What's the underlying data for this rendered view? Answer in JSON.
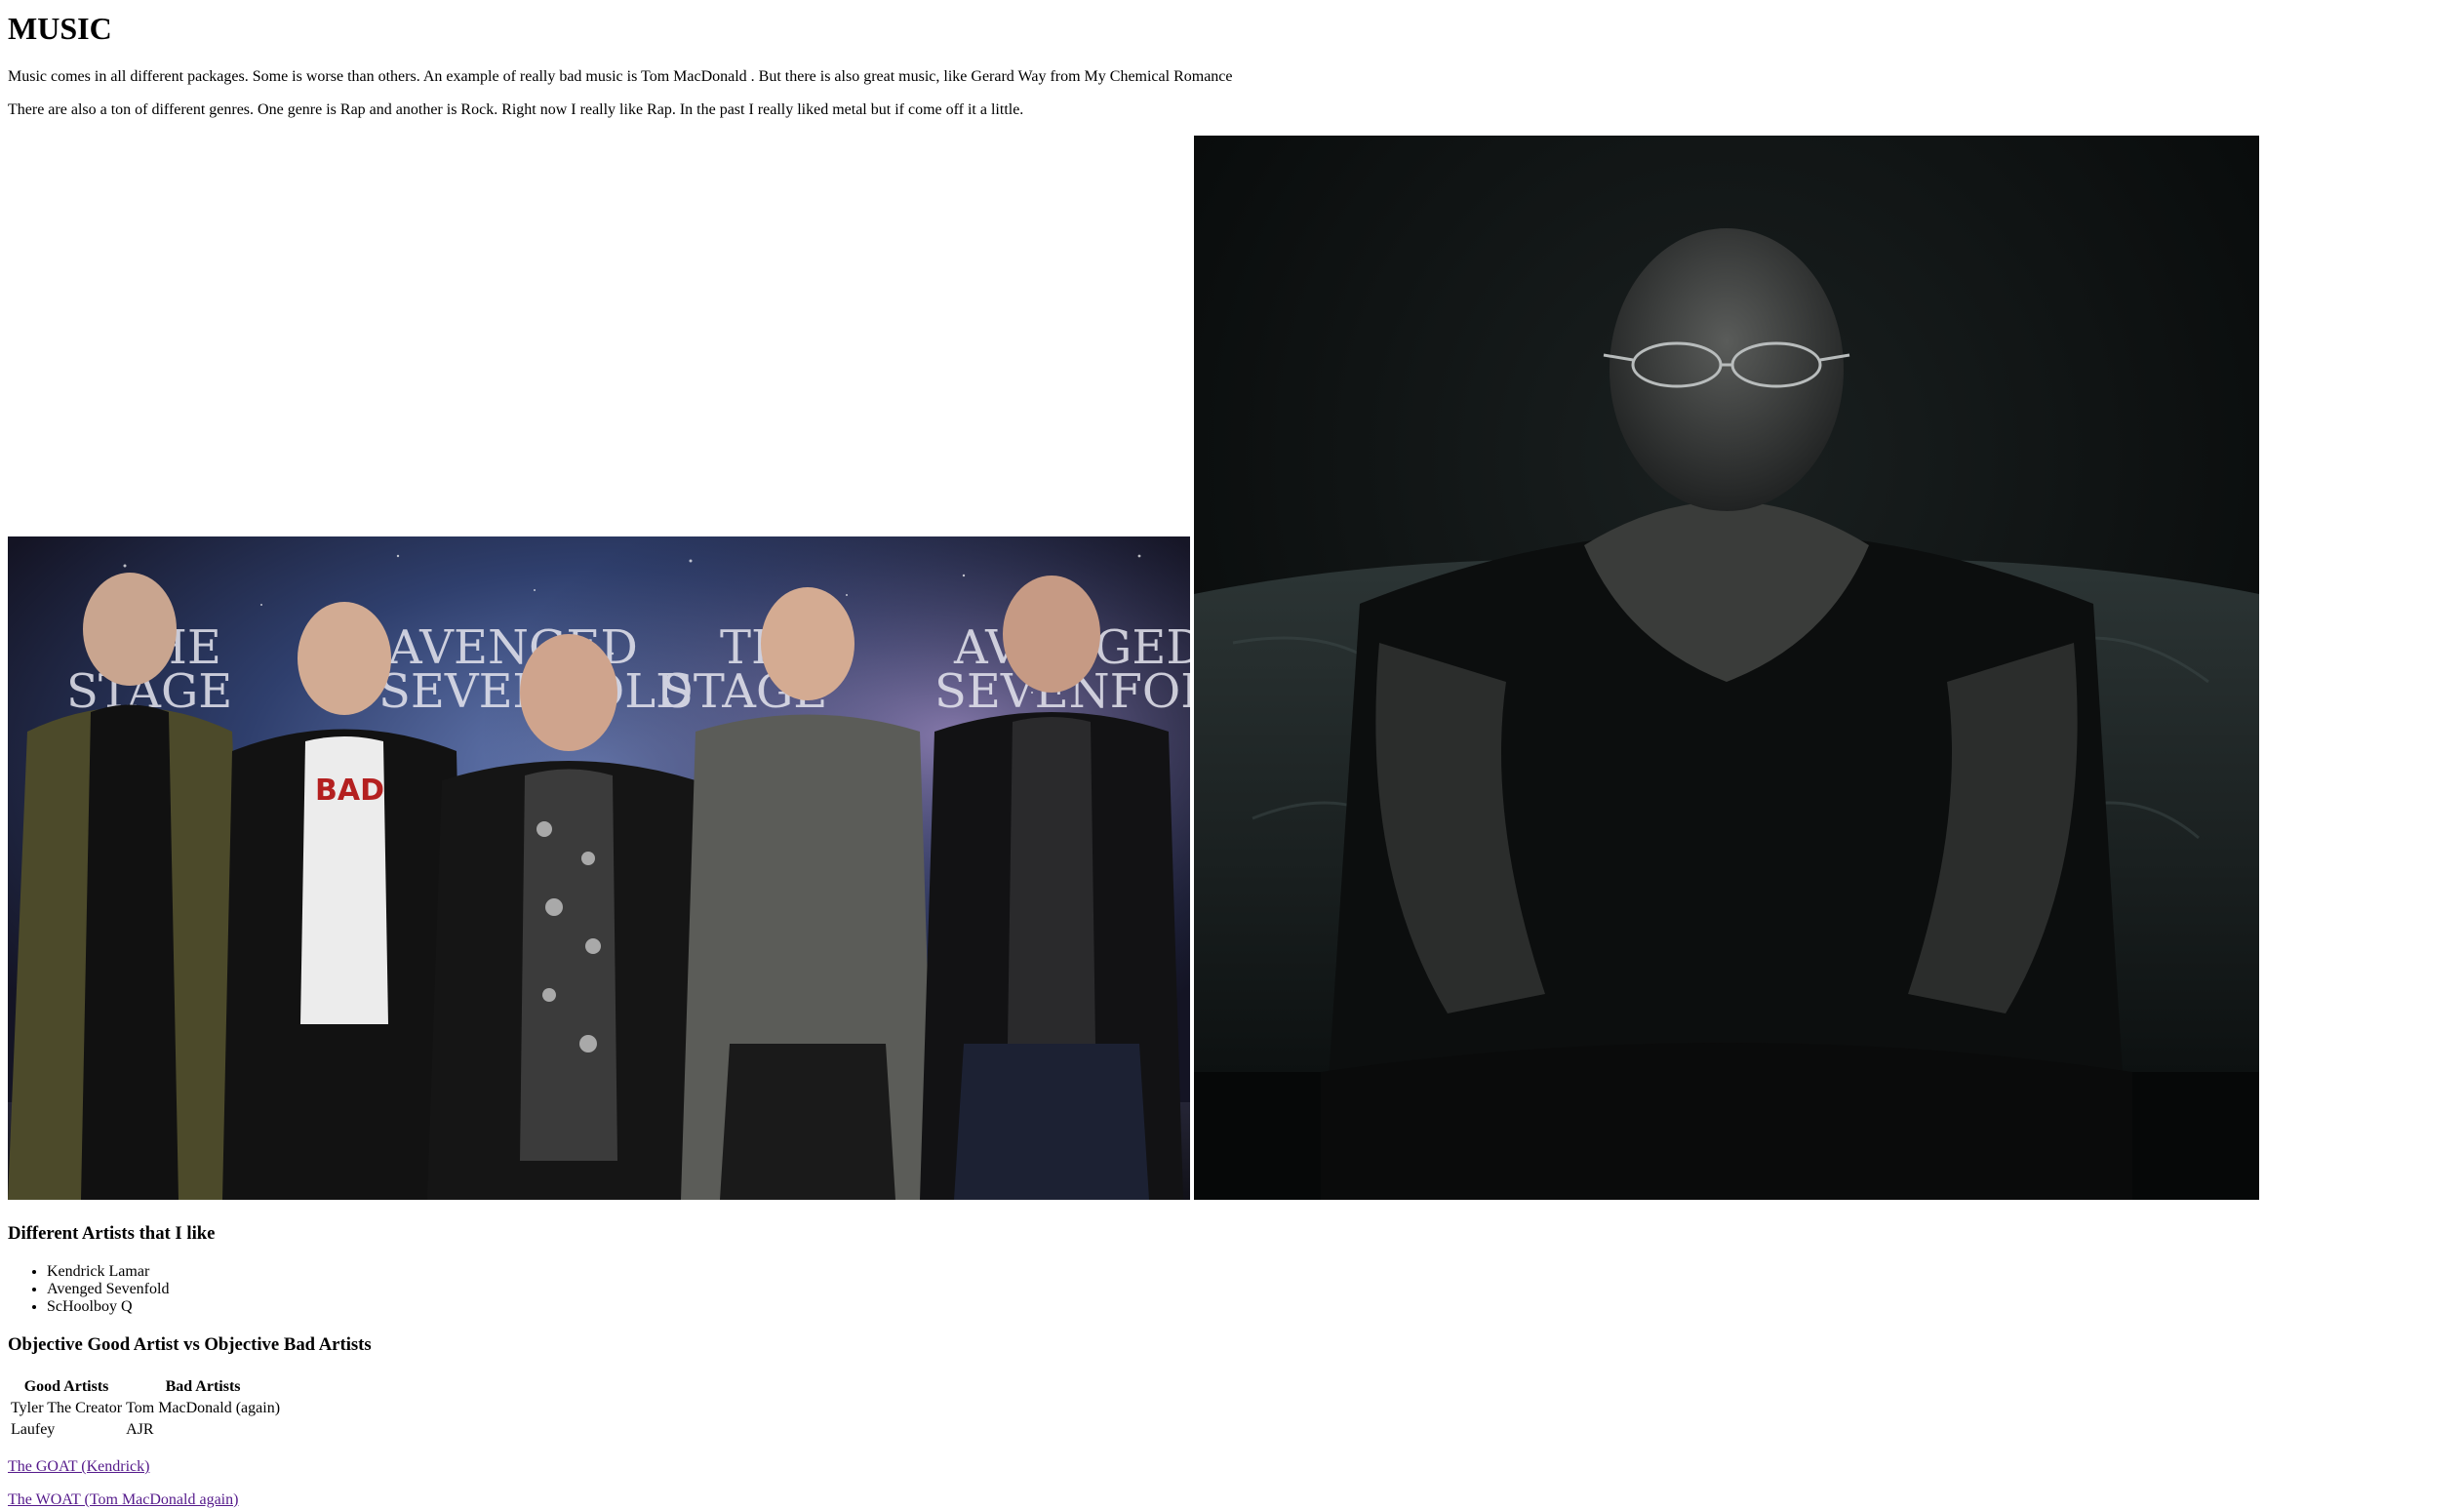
{
  "page": {
    "title": "MUSIC",
    "paragraphs": [
      "Music comes in all different packages. Some is worse than others. An example of really bad music is Tom MacDonald . But there is also great music, like Gerard Way from My Chemical Romance",
      "There are also a ton of different genres. One genre is Rap and another is Rock. Right now I really like Rap. In the past I really liked metal but if come off it a little."
    ]
  },
  "images": {
    "band_photo": "band-photo-image",
    "portrait_photo": "portrait-photo-image"
  },
  "artists_section": {
    "heading": "Different Artists that I like",
    "items": [
      "Kendrick Lamar",
      "Avenged Sevenfold",
      "ScHoolboy Q"
    ]
  },
  "table_section": {
    "heading": "Objective Good Artist vs Objective Bad Artists",
    "headers": [
      "Good Artists",
      "Bad Artists"
    ],
    "rows": [
      [
        "Tyler The Creator",
        "Tom MacDonald (again)"
      ],
      [
        "Laufey",
        "AJR"
      ]
    ]
  },
  "links": {
    "goat": "The GOAT (Kendrick)",
    "woat": "The WOAT (Tom MacDonald again)"
  },
  "colors": {
    "link_visited": "#551a8b",
    "text": "#000000",
    "background": "#ffffff"
  }
}
